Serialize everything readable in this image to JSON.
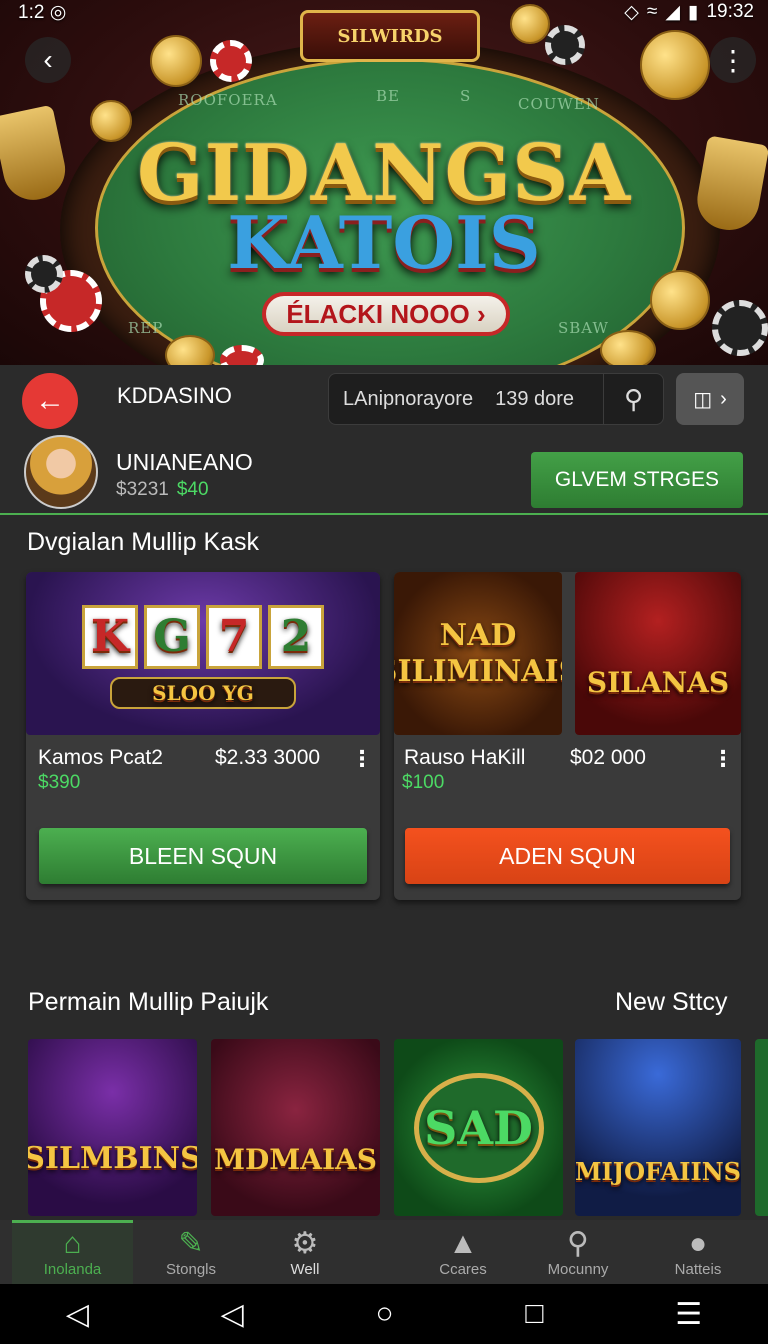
{
  "status_bar": {
    "left_time": "1:2",
    "right_time": "19:32"
  },
  "hero": {
    "sign": "SILWIRDS",
    "title": "GIDANGSA",
    "subtitle": "KATOIS",
    "cta_label": "ÉLACKI NOOO ›",
    "felt_texts": [
      "ROOFOERA",
      "BE",
      "S",
      "COUWEN",
      "SBAW",
      "REP"
    ]
  },
  "header": {
    "brand": "KDDASINO",
    "search_value": "LAnipnorayore",
    "search_count": "139 dore",
    "username": "UNIANEANO",
    "balance": "$3231",
    "balance_bonus": "$40",
    "top_button": "GLVEM STRGES"
  },
  "section1": {
    "title": "Dvgialan Mullip Kask",
    "thumbs": [
      "SLOO YG",
      "NAD SILIMINAIS",
      "SILANAS"
    ],
    "reel_symbols": [
      "K",
      "G",
      "7",
      "2"
    ],
    "cards": [
      {
        "name": "Kamos Pcat2",
        "price": "$2.33 3000",
        "bonus": "$390",
        "button": "BLEEN SQUN"
      },
      {
        "name": "Rauso HaKill",
        "price": "$02 000",
        "bonus": "$100",
        "button": "ADEN SQUN"
      }
    ]
  },
  "section2": {
    "title": "Permain Mullip Paiujk",
    "link": "New Sttcy",
    "thumbs": [
      "SILMBINS",
      "MDMAIAS",
      "SAD",
      "MIJOFAIINS"
    ]
  },
  "bottom_nav": [
    {
      "label": "Inolanda",
      "icon": "home-icon"
    },
    {
      "label": "Stongls",
      "icon": "edit-icon"
    },
    {
      "label": "Well",
      "icon": "wheel-icon"
    },
    {
      "label": "Ccares",
      "icon": "trophy-icon"
    },
    {
      "label": "Mocunny",
      "icon": "search-icon"
    },
    {
      "label": "Natteis",
      "icon": "person-icon"
    }
  ],
  "colors": {
    "accent_green": "#4caf50",
    "accent_red": "#e53935",
    "bonus_green": "#4cd964",
    "background": "#2a2a2a"
  }
}
